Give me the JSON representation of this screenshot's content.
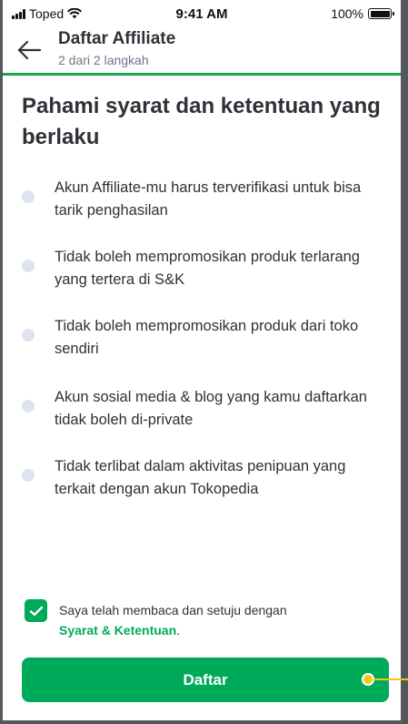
{
  "status_bar": {
    "carrier": "Toped",
    "time": "9:41 AM",
    "battery": "100%"
  },
  "header": {
    "title": "Daftar Affiliate",
    "subtitle": "2 dari 2 langkah",
    "back_icon": "arrow-left-icon"
  },
  "page": {
    "heading": "Pahami syarat dan ketentuan yang berlaku",
    "terms": [
      "Akun Affiliate-mu harus terverifikasi untuk bisa tarik penghasilan",
      "Tidak boleh mempromosikan produk terlarang yang tertera di S&K",
      "Tidak boleh mempromosikan produk dari toko sendiri",
      "Akun sosial media & blog yang kamu daftarkan tidak boleh di-private",
      "Tidak terlibat dalam aktivitas penipuan yang terkait dengan akun Tokopedia"
    ]
  },
  "agreement": {
    "checked": true,
    "text": "Saya telah membaca dan setuju dengan",
    "link": "Syarat & Ketentuan",
    "suffix": "."
  },
  "button": {
    "label": "Daftar"
  },
  "colors": {
    "brand_green": "#00aa5b",
    "header_underline": "#1aa64f",
    "bullet": "#dde3ef",
    "hotspot": "#f5c518"
  }
}
